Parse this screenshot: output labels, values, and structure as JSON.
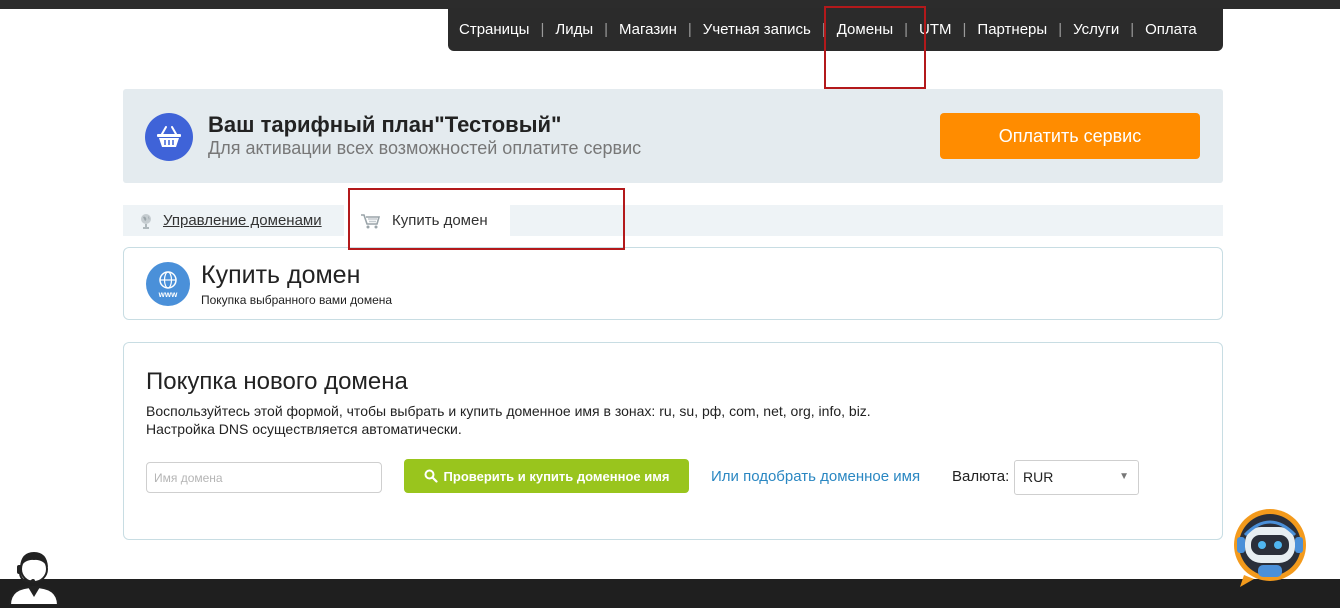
{
  "nav": {
    "items": [
      {
        "label": "Страницы"
      },
      {
        "label": "Лиды"
      },
      {
        "label": "Магазин"
      },
      {
        "label": "Учетная запись"
      },
      {
        "label": "Домены"
      },
      {
        "label": "UTM"
      },
      {
        "label": "Партнеры"
      },
      {
        "label": "Услуги"
      },
      {
        "label": "Оплата"
      }
    ],
    "separator": "|"
  },
  "plan": {
    "title": "Ваш тарифный план\"Тестовый\"",
    "subtitle": "Для активации всех возможностей оплатите сервис",
    "pay_button": "Оплатить сервис",
    "icon": "basket-icon"
  },
  "tabs": {
    "manage_label": "Управление доменами",
    "buy_label": "Купить домен",
    "manage_icon": "globe-icon",
    "buy_icon": "cart-icon"
  },
  "header_card": {
    "title": "Купить домен",
    "subtitle": "Покупка выбранного вами домена",
    "icon_text": "www"
  },
  "form": {
    "title": "Покупка нового домена",
    "desc_line1": "Воспользуйтесь этой формой, чтобы выбрать и купить доменное имя в зонах: ru, su, рф, com, net, org, info, biz.",
    "desc_line2": "Настройка DNS осуществляется автоматически.",
    "input_placeholder": "Имя домена",
    "input_value": "",
    "check_button": "Проверить и купить доменное имя",
    "pick_link": "Или подобрать доменное имя",
    "currency_label": "Валюта:",
    "currency_value": "RUR",
    "currency_arrow": "▼"
  },
  "colors": {
    "nav_bg": "#2b2b2b",
    "pay_button": "#ff8c00",
    "check_button": "#99c51d",
    "link": "#2a87c2",
    "highlight": "#b3191b"
  }
}
